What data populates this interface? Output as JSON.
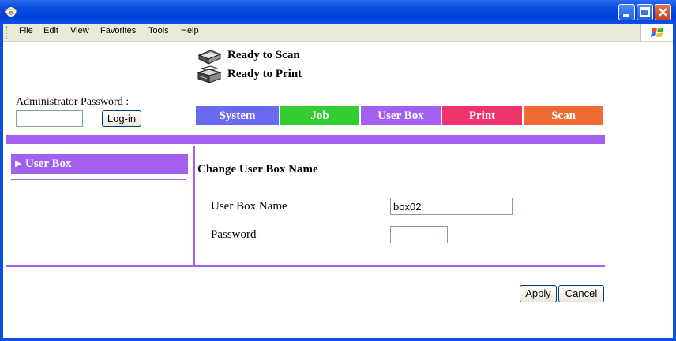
{
  "menubar": {
    "items": [
      "File",
      "Edit",
      "View",
      "Favorites",
      "Tools",
      "Help"
    ]
  },
  "status": {
    "scan": "Ready to Scan",
    "print": "Ready to Print"
  },
  "login": {
    "label": "Administrator Password :",
    "password_value": "",
    "button": "Log-in"
  },
  "tabs": [
    {
      "label": "System",
      "color": "#6a6af0"
    },
    {
      "label": "Job",
      "color": "#33cc33"
    },
    {
      "label": "User Box",
      "color": "#a35ff0"
    },
    {
      "label": "Print",
      "color": "#f0336a"
    },
    {
      "label": "Scan",
      "color": "#f06a33"
    }
  ],
  "sidebar": {
    "item": "User Box"
  },
  "form": {
    "title": "Change User Box Name",
    "name_label": "User Box Name",
    "name_value": "box02",
    "password_label": "Password",
    "password_value": ""
  },
  "actions": {
    "apply": "Apply",
    "cancel": "Cancel"
  }
}
